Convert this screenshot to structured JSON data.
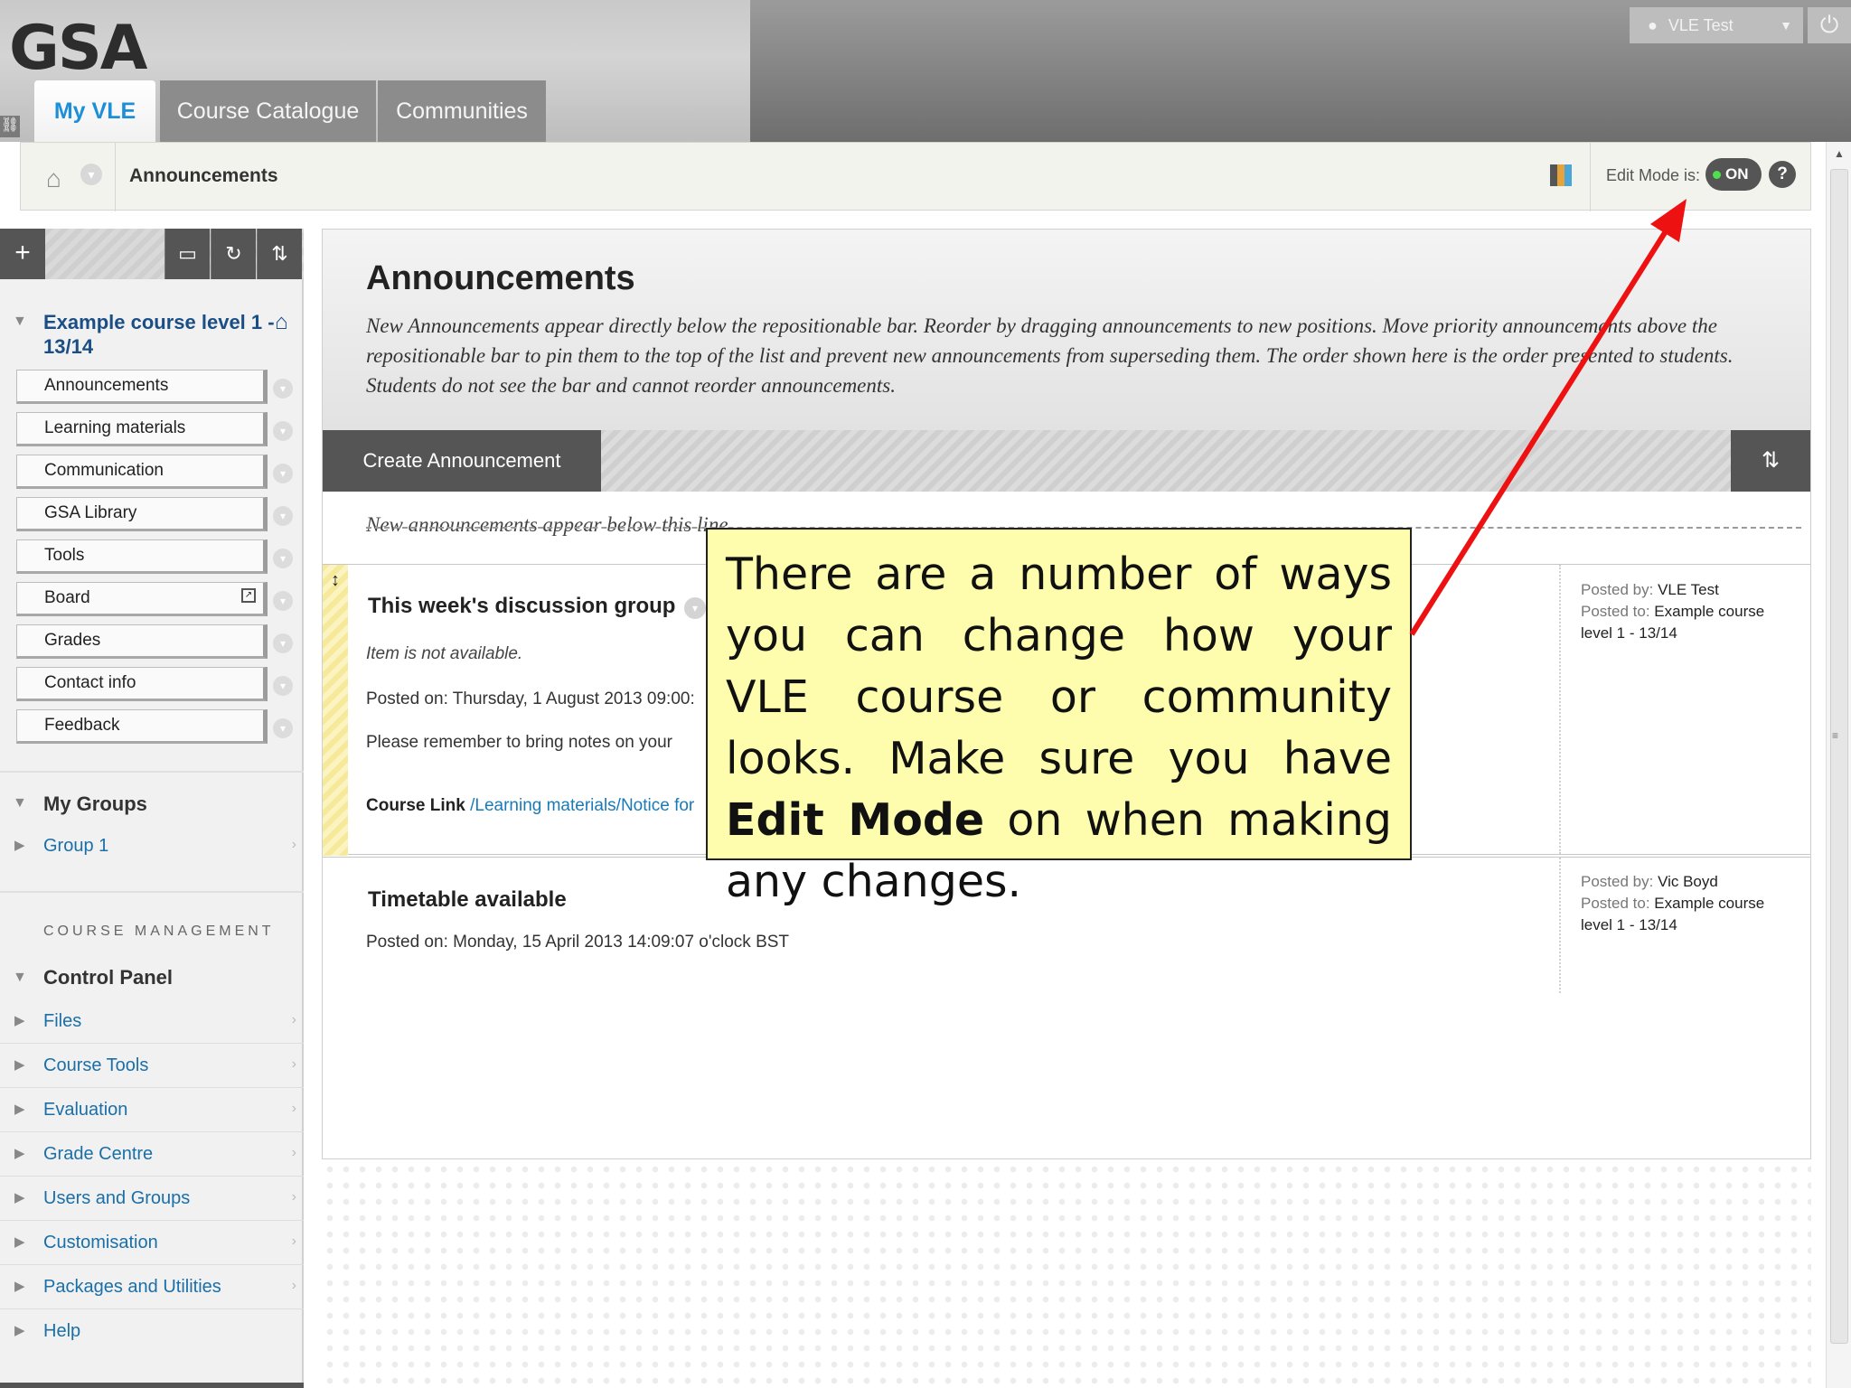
{
  "header": {
    "logo": "GSA",
    "tabs": [
      "My VLE",
      "Course Catalogue",
      "Communities"
    ],
    "user": "VLE Test"
  },
  "breadcrumb": {
    "current": "Announcements",
    "edit_mode_label": "Edit Mode is:",
    "edit_mode_value": "ON",
    "help": "?"
  },
  "sidebar": {
    "course_title": "Example course level 1 - 13/14",
    "menu_items": [
      "Announcements",
      "Learning materials",
      "Communication",
      "GSA Library",
      "Tools",
      "Board",
      "Grades",
      "Contact info",
      "Feedback"
    ],
    "my_groups_heading": "My Groups",
    "groups": [
      "Group 1"
    ],
    "course_management_label": "COURSE MANAGEMENT",
    "control_panel_heading": "Control Panel",
    "control_panel_items": [
      "Files",
      "Course Tools",
      "Evaluation",
      "Grade Centre",
      "Users and Groups",
      "Customisation",
      "Packages and Utilities",
      "Help"
    ]
  },
  "main": {
    "title": "Announcements",
    "description": "New Announcements appear directly below the repositionable bar. Reorder by dragging announcements to new positions. Move priority announcements above the repositionable bar to pin them to the top of the list and prevent new announcements from superseding them. The order shown here is the order presented to students. Students do not see the bar and cannot reorder announcements.",
    "create_button": "Create Announcement",
    "new_line_text": "New announcements appear below this line",
    "announcements": [
      {
        "title": "This week's discussion group",
        "status": "Item is not available.",
        "posted_on": "Posted on: Thursday, 1 August 2013 09:00:",
        "body": "Please remember to bring notes on your",
        "link_label": "Course Link",
        "link_text": "/Learning materials/Notice for",
        "posted_by_label": "Posted by:",
        "posted_by": "VLE Test",
        "posted_to_label": "Posted to:",
        "posted_to": "Example course level 1 - 13/14"
      },
      {
        "title": "Timetable available",
        "posted_on": "Posted on: Monday, 15 April 2013 14:09:07 o'clock BST",
        "posted_by_label": "Posted by:",
        "posted_by": "Vic Boyd",
        "posted_to_label": "Posted to:",
        "posted_to": "Example course level 1 - 13/14"
      }
    ]
  },
  "callout": {
    "text_before": "There are a number of ways you can change how your VLE course or community looks. Make sure you have ",
    "bold": "Edit Mode",
    "text_after": " on when making any changes."
  },
  "colors": {
    "callout_bg": "#fdfdad",
    "arrow": "#ee1111",
    "link": "#1a6fa8",
    "toolbar": "#555555"
  },
  "icons": [
    "home-icon",
    "palette-icon",
    "help-icon",
    "power-icon",
    "user-icon",
    "plus-icon",
    "folder-icon",
    "refresh-icon",
    "sort-icon",
    "drag-handle-icon"
  ]
}
